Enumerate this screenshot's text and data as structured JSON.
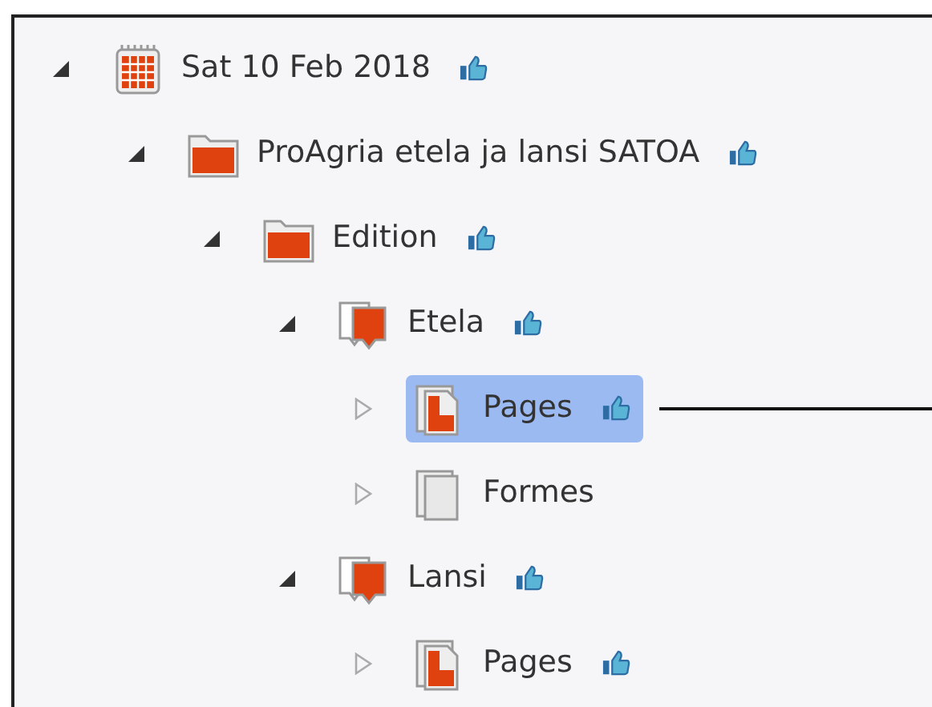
{
  "tree": [
    {
      "label": "Sat 10 Feb 2018",
      "kind": "calendar",
      "expanded": true,
      "approved": true,
      "selected": false,
      "children": [
        {
          "label": "ProAgria etela ja lansi SATOA",
          "kind": "folder",
          "expanded": true,
          "approved": true,
          "selected": false,
          "children": [
            {
              "label": "Edition",
              "kind": "folder",
              "expanded": true,
              "approved": true,
              "selected": false,
              "children": [
                {
                  "label": "Etela",
                  "kind": "section",
                  "expanded": true,
                  "approved": true,
                  "selected": false,
                  "children": [
                    {
                      "label": "Pages",
                      "kind": "pages",
                      "expanded": false,
                      "approved": true,
                      "selected": true
                    },
                    {
                      "label": "Formes",
                      "kind": "formes",
                      "expanded": false,
                      "approved": false,
                      "selected": false
                    }
                  ]
                },
                {
                  "label": "Lansi",
                  "kind": "section",
                  "expanded": true,
                  "approved": true,
                  "selected": false,
                  "children": [
                    {
                      "label": "Pages",
                      "kind": "pages",
                      "expanded": false,
                      "approved": true,
                      "selected": false
                    }
                  ]
                }
              ]
            }
          ]
        }
      ]
    }
  ]
}
